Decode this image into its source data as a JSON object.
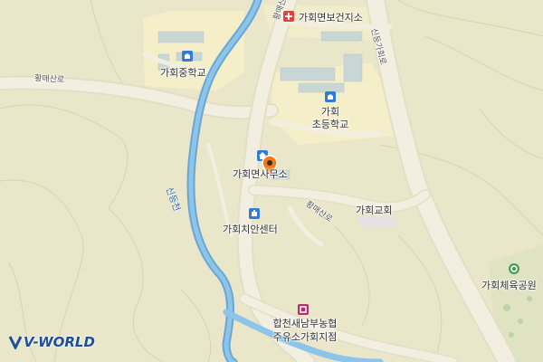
{
  "map": {
    "provider_logo": "V-WORLD",
    "labels": {
      "health_center": "가회면보건지소",
      "middle_school": "가회중학교",
      "elementary_school_line1": "가회",
      "elementary_school_line2": "초등학교",
      "office": "가회면사무소",
      "church": "가회교회",
      "police_center": "가회치안센터",
      "park": "가회체육공원",
      "coop_line1": "합천새남부농협",
      "coop_line2": "주유소가회지점",
      "road_hwangmae_west": "황매산로",
      "road_hwangmae_north": "황매산로",
      "road_hwangmae_east": "황매산로",
      "road_sindeung": "신등가회로",
      "stream": "신등천"
    },
    "colors": {
      "background": "#e9e6c9",
      "school_area": "#f4efc8",
      "river": "#7ab6e0",
      "road": "#f3efe0",
      "poi_blue": "#2f7bd6",
      "poi_health": "#e0433c",
      "poi_coop": "#b0306e",
      "marker": "#f07a16",
      "park_green": "#a7c98a"
    },
    "icons": {
      "health_center": "hospital-icon",
      "middle_school": "school-icon",
      "elementary_school": "school-icon",
      "office": "government-office-icon",
      "police_center": "police-icon",
      "park": "park-icon",
      "coop": "gas-station-icon",
      "location": "location-marker-icon"
    }
  }
}
